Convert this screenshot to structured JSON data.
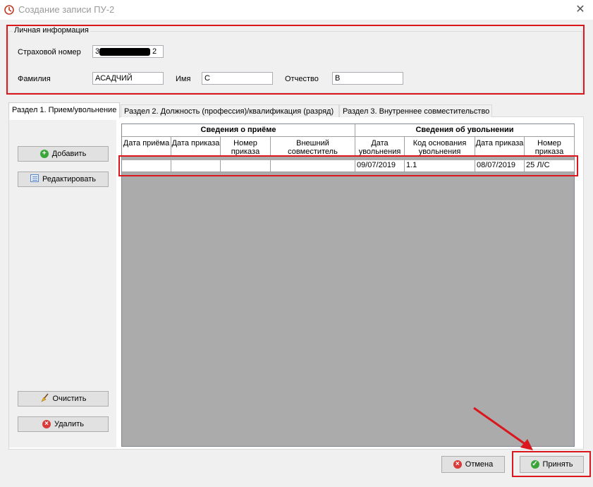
{
  "window": {
    "title": "Создание записи ПУ-2",
    "close_glyph": "✕"
  },
  "personal": {
    "legend": "Личная информация",
    "insurance_label": "Страховой номер",
    "insurance_prefix": "3",
    "insurance_suffix": "2",
    "surname_label": "Фамилия",
    "surname_value": "АСАДЧИЙ",
    "name_label": "Имя",
    "name_value": "С",
    "patronymic_label": "Отчество",
    "patronymic_value": "В"
  },
  "tabs": [
    {
      "label": "Раздел 1. Прием/увольнение",
      "active": true
    },
    {
      "label": "Раздел 2. Должность (профессия)/квалификация (разряд)",
      "active": false
    },
    {
      "label": "Раздел 3. Внутреннее совместительство",
      "active": false
    }
  ],
  "side_buttons": {
    "add": "Добавить",
    "edit": "Редактировать",
    "clear": "Очистить",
    "delete": "Удалить"
  },
  "table": {
    "group_hire": "Сведения о приёме",
    "group_dismissal": "Сведения об увольнении",
    "columns": [
      "Дата приёма",
      "Дата приказа",
      "Номер приказа",
      "Внешний совместитель",
      "Дата увольнения",
      "Код основания увольнения",
      "Дата приказа",
      "Номер приказа"
    ],
    "rows": [
      [
        "",
        "",
        "",
        "",
        "09/07/2019",
        "1.1",
        "08/07/2019",
        "25 Л/С"
      ]
    ]
  },
  "footer": {
    "cancel": "Отмена",
    "accept": "Принять"
  },
  "colors": {
    "highlight": "#d9171c",
    "add_icon": "#3aa63a",
    "delete_icon": "#d93a3a",
    "accept_icon": "#3aa63a"
  },
  "icons": {
    "add": "plus-circle-icon",
    "edit": "list-icon",
    "clear": "broom-icon",
    "delete": "x-circle-icon",
    "cancel": "x-circle-icon",
    "accept": "check-circle-icon"
  }
}
